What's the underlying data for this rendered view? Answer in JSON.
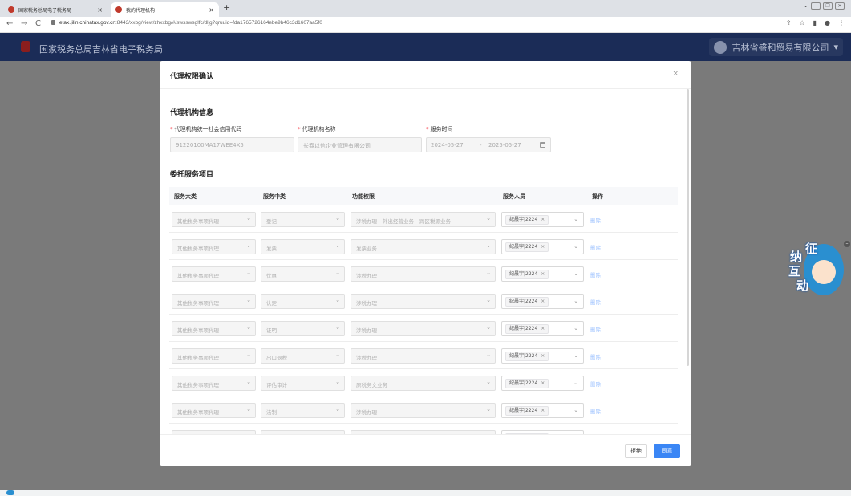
{
  "browser": {
    "tabs": [
      {
        "label": "国家税务总局电子税务局",
        "active": false
      },
      {
        "label": "我的代理机构",
        "active": true
      }
    ],
    "url_host": "etax.jilin.chinatax.gov.cn",
    "url_path": ":8443/xxbg/view/zhxxbg/#/swsswsglfc/dljg?qruuid=fda1765726164ebe9b46c3d1607aa5f0"
  },
  "app": {
    "title": "国家税务总局吉林省电子税务局",
    "company": "吉林省盛和贸易有限公司",
    "mascot_chars": [
      "征",
      "纳",
      "互",
      "动"
    ]
  },
  "modal": {
    "title": "代理权限确认",
    "close_icon": "×",
    "agency_section_title": "代理机构信息",
    "fields": {
      "credit_code_label": "代理机构统一社会信用代码",
      "credit_code_value": "91220100MA17WEE4X5",
      "agency_name_label": "代理机构名称",
      "agency_name_value": "长春以信企业管理有限公司",
      "service_time_label": "服务时间",
      "service_start": "2024-05-27",
      "date_sep": "-",
      "service_end": "2025-05-27"
    },
    "items_section_title": "委托服务项目",
    "columns": [
      "服务大类",
      "服务中类",
      "功能权限",
      "服务人员",
      "操作"
    ],
    "rows": [
      {
        "major": "其他税务事项代理",
        "middle": "登记",
        "perms": [
          "涉税办理",
          "外出经营业务",
          "跨区税源业务"
        ],
        "staff": "纪晨宇|2224",
        "action": "删除"
      },
      {
        "major": "其他税务事项代理",
        "middle": "发票",
        "perms": [
          "发票业务"
        ],
        "staff": "纪晨宇|2224",
        "action": "删除"
      },
      {
        "major": "其他税务事项代理",
        "middle": "优惠",
        "perms": [
          "涉税办理"
        ],
        "staff": "纪晨宇|2224",
        "action": "删除"
      },
      {
        "major": "其他税务事项代理",
        "middle": "认定",
        "perms": [
          "涉税办理"
        ],
        "staff": "纪晨宇|2224",
        "action": "删除"
      },
      {
        "major": "其他税务事项代理",
        "middle": "证明",
        "perms": [
          "涉税办理"
        ],
        "staff": "纪晨宇|2224",
        "action": "删除"
      },
      {
        "major": "其他税务事项代理",
        "middle": "出口退税",
        "perms": [
          "涉税办理"
        ],
        "staff": "纪晨宇|2224",
        "action": "删除"
      },
      {
        "major": "其他税务事项代理",
        "middle": "评估审计",
        "perms": [
          "原税务文业务"
        ],
        "staff": "纪晨宇|2224",
        "action": "删除"
      },
      {
        "major": "其他税务事项代理",
        "middle": "法制",
        "perms": [
          "涉税办理"
        ],
        "staff": "纪晨宇|2224",
        "action": "删除"
      },
      {
        "major": "其他税务事项代理",
        "middle": "综合",
        "perms": [
          "涉税办理"
        ],
        "staff": "纪晨宇|2224",
        "action": "删除"
      }
    ],
    "reject_label": "拒绝",
    "agree_label": "同意"
  }
}
